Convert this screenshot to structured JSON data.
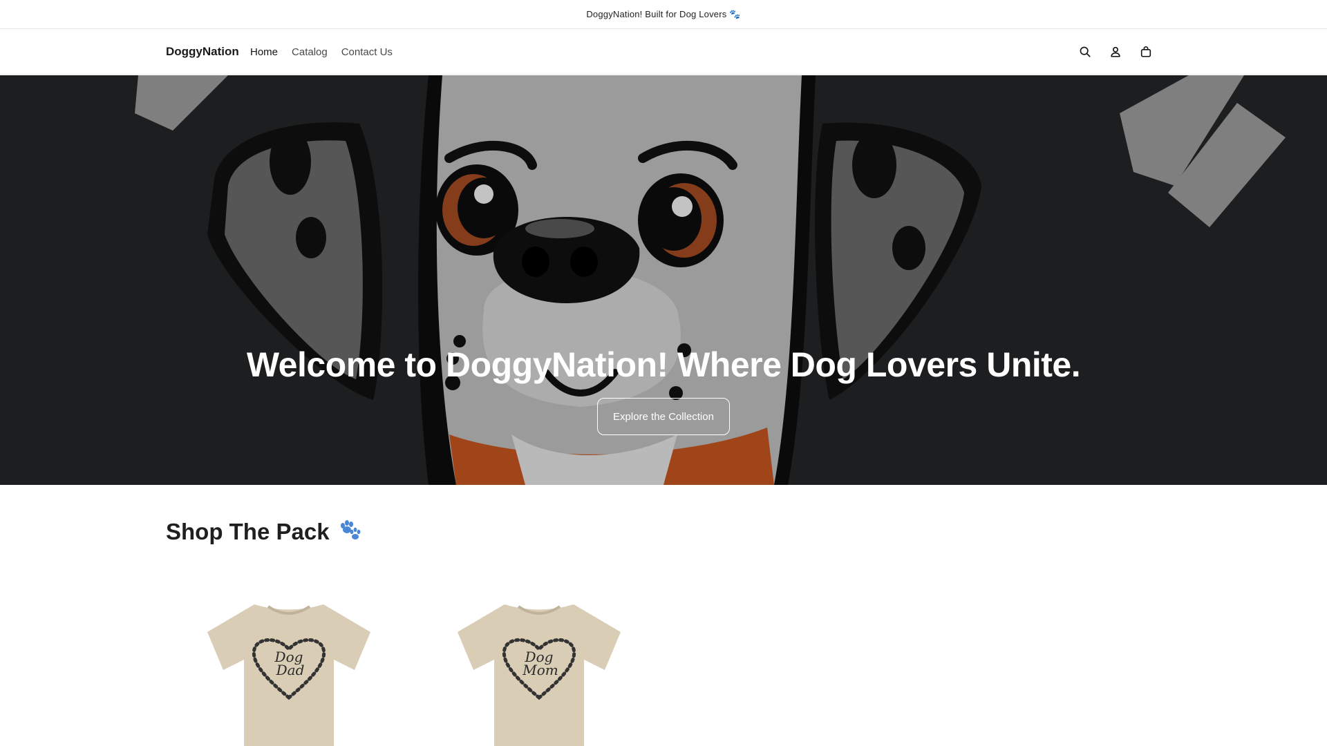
{
  "announcement": {
    "text": "DoggyNation! Built for Dog Lovers 🐾"
  },
  "header": {
    "logo": "DoggyNation",
    "nav": [
      {
        "label": "Home"
      },
      {
        "label": "Catalog"
      },
      {
        "label": "Contact Us"
      }
    ],
    "icons": [
      "search-icon",
      "account-icon",
      "cart-icon"
    ]
  },
  "hero": {
    "title": "Welcome to DoggyNation! Where Dog Lovers Unite.",
    "button_label": "Explore the Collection"
  },
  "collection": {
    "title": "Shop The Pack",
    "title_icon": "paw-prints-icon",
    "products": [
      {
        "shirt_text_line1": "Dog",
        "shirt_text_line2": "Dad"
      },
      {
        "shirt_text_line1": "Dog",
        "shirt_text_line2": "Mom"
      }
    ]
  },
  "colors": {
    "hero_bg": "#232527",
    "paw_blue": "#4a86d8",
    "shirt_sand": "#d9cdb6",
    "dog_collar": "#c4531f",
    "dog_eye": "#a14a21"
  }
}
